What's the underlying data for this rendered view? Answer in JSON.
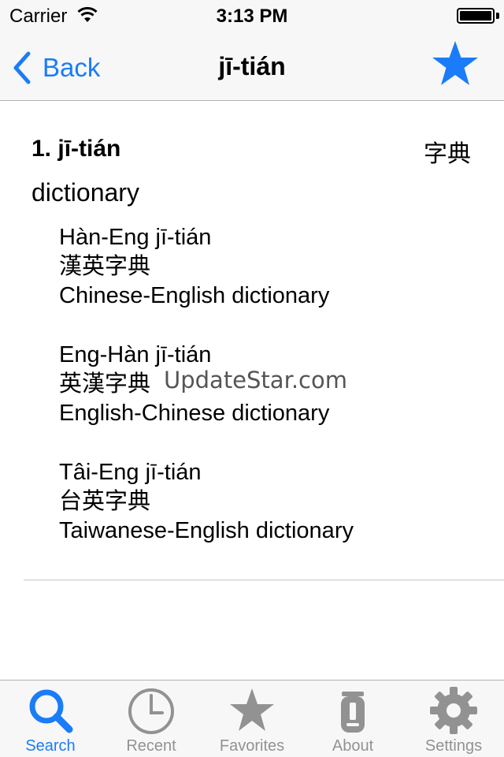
{
  "status_bar": {
    "carrier": "Carrier",
    "time": "3:13 PM"
  },
  "nav": {
    "back_label": "Back",
    "title": "jī-tián"
  },
  "entry": {
    "heading": "1. jī-tián",
    "hanzi": "字典",
    "gloss": "dictionary",
    "examples": [
      {
        "romanization": "Hàn-Eng jī-tián",
        "hanzi": "漢英字典",
        "translation": "Chinese-English dictionary"
      },
      {
        "romanization": "Eng-Hàn jī-tián",
        "hanzi": "英漢字典",
        "translation": "English-Chinese dictionary"
      },
      {
        "romanization": "Tâi-Eng jī-tián",
        "hanzi": "台英字典",
        "translation": "Taiwanese-English dictionary"
      }
    ]
  },
  "watermark": "UpdateStar.com",
  "tabs": [
    {
      "label": "Search",
      "icon": "search-icon",
      "active": true
    },
    {
      "label": "Recent",
      "icon": "clock-icon",
      "active": false
    },
    {
      "label": "Favorites",
      "icon": "star-icon",
      "active": false
    },
    {
      "label": "About",
      "icon": "about-icon",
      "active": false
    },
    {
      "label": "Settings",
      "icon": "gear-icon",
      "active": false
    }
  ],
  "colors": {
    "accent": "#1a7cf8",
    "inactive": "#929292",
    "bar_background": "#f7f7f7"
  }
}
